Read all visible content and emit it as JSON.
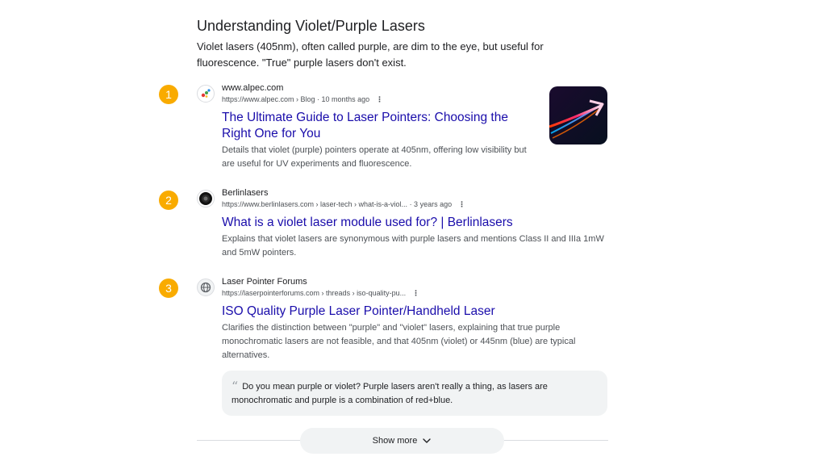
{
  "overview": {
    "heading": "Understanding Violet/Purple Lasers",
    "summary": "Violet lasers (405nm), often called purple, are dim to the eye, but useful for fluorescence. \"True\" purple lasers don't exist."
  },
  "results": [
    {
      "number": "1",
      "site_name": "www.alpec.com",
      "url": "https://www.alpec.com › Blog · 10 months ago",
      "title_line1": "The Ultimate Guide to Laser Pointers: Choosing the",
      "title_line2": "Right One for You",
      "snippet_line1": "Details that violet (purple) pointers operate at 405nm, offering low visibility but",
      "snippet_line2": "are useful for UV experiments and fluorescence.",
      "icon": "alpec-dots-icon"
    },
    {
      "number": "2",
      "site_name": "Berlinlasers",
      "url": "https://www.berlinlasers.com › laser-tech › what-is-a-viol... · 3 years ago",
      "title": "What is a violet laser module used for? | Berlinlasers",
      "snippet_line1": "Explains that violet lasers are synonymous with purple lasers and mentions Class II and IIIa 1mW",
      "snippet_line2": "and 5mW pointers.",
      "icon": "lens-icon"
    },
    {
      "number": "3",
      "site_name": "Laser Pointer Forums",
      "url": "https://laserpointerforums.com › threads › iso-quality-pu...",
      "title": "ISO Quality Purple Laser Pointer/Handheld Laser",
      "snippet_line1": "Clarifies the distinction between \"purple\" and \"violet\" lasers, explaining that true purple",
      "snippet_line2": "monochromatic lasers are not feasible, and that 405nm (violet) or 445nm (blue) are typical",
      "snippet_line3": "alternatives.",
      "quote_line1": "Do you mean purple or violet? Purple lasers aren't really a thing, as lasers are",
      "quote_line2": "monochromatic and purple is a combination of red+blue.",
      "icon": "globe-icon"
    }
  ],
  "more_menu_glyph": "⋮",
  "quote_glyph": "“",
  "show_more": {
    "label": "Show more"
  },
  "colors": {
    "badge": "#f9ab00",
    "link": "#1a0dab"
  }
}
